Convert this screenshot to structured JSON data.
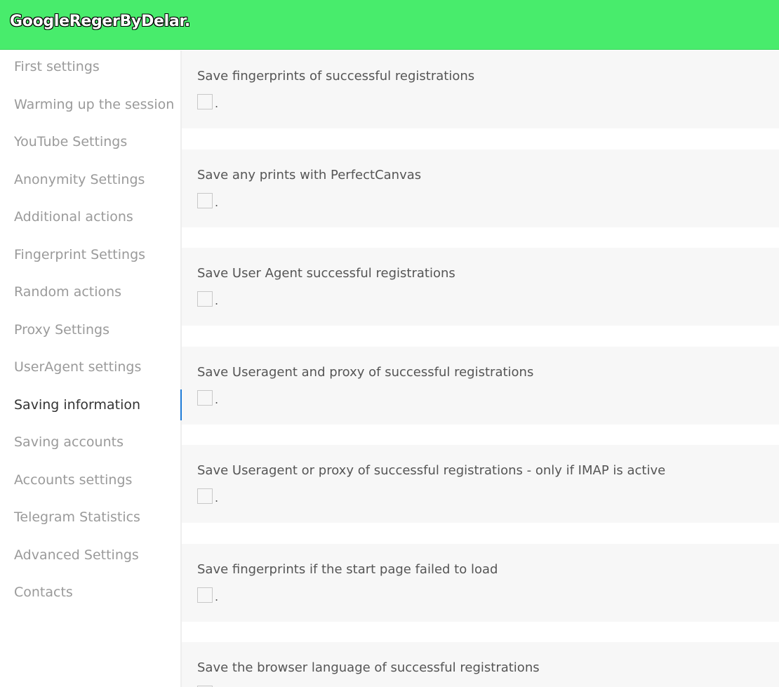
{
  "app": {
    "title": "GoogleRegerByDelar."
  },
  "sidebar": {
    "items": [
      {
        "label": "First settings"
      },
      {
        "label": "Warming up the session"
      },
      {
        "label": "YouTube Settings"
      },
      {
        "label": "Anonymity Settings"
      },
      {
        "label": "Additional actions"
      },
      {
        "label": "Fingerprint Settings"
      },
      {
        "label": "Random actions"
      },
      {
        "label": "Proxy Settings"
      },
      {
        "label": "UserAgent settings"
      },
      {
        "label": "Saving information",
        "active": true
      },
      {
        "label": "Saving accounts"
      },
      {
        "label": "Accounts settings"
      },
      {
        "label": "Telegram Statistics"
      },
      {
        "label": "Advanced Settings"
      },
      {
        "label": "Contacts"
      }
    ]
  },
  "options": [
    {
      "label": "Save fingerprints of successful registrations",
      "checked": false,
      "suffix": "."
    },
    {
      "label": "Save any prints with PerfectCanvas",
      "checked": false,
      "suffix": "."
    },
    {
      "label": "Save User Agent successful registrations",
      "checked": false,
      "suffix": "."
    },
    {
      "label": "Save Useragent and proxy of successful registrations",
      "checked": false,
      "suffix": "."
    },
    {
      "label": "Save Useragent or proxy of successful registrations - only if IMAP is active",
      "checked": false,
      "suffix": "."
    },
    {
      "label": "Save fingerprints if the start page failed to load",
      "checked": false,
      "suffix": "."
    },
    {
      "label": "Save the browser language of successful registrations",
      "checked": false,
      "suffix": "."
    }
  ],
  "colors": {
    "header": "#48ec6c",
    "active_indicator": "#1e7ad6"
  }
}
